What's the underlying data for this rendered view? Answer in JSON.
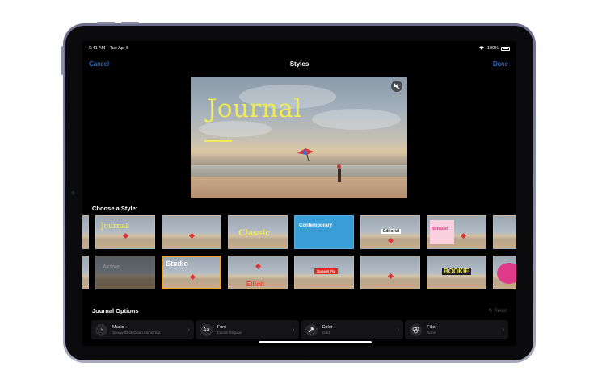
{
  "status": {
    "time": "9:41 AM",
    "date": "Tue Apr 5",
    "battery": "100%"
  },
  "nav": {
    "cancel": "Cancel",
    "title": "Styles",
    "done": "Done"
  },
  "preview": {
    "title": "Journal"
  },
  "choose_label": "Choose a Style:",
  "style_tiles_row1": [
    {
      "text": "",
      "color": "#f2ea55"
    },
    {
      "text": "Journal",
      "color": "#f2ea55"
    },
    {
      "text": "",
      "color": "#ffffff"
    },
    {
      "text": "Classic",
      "color": "#f2ea55"
    },
    {
      "text": "Contemporary",
      "color": "#ffffff"
    },
    {
      "text": "Editorial",
      "color": "#222222"
    },
    {
      "text": "Notepad",
      "color": "#e03a8a"
    },
    {
      "text": "",
      "color": "#f2ea55"
    }
  ],
  "style_tiles_row2": [
    {
      "text": "",
      "color": "#ffffff"
    },
    {
      "text": "Active",
      "color": "#ffffff"
    },
    {
      "text": "Studio",
      "color": "#ffffff"
    },
    {
      "text": "Elliott",
      "color": "#ff3b30"
    },
    {
      "text": "Sunset Fix",
      "color": "#ffffff"
    },
    {
      "text": "",
      "color": "#ffffff"
    },
    {
      "text": "BOOKIE",
      "color": "#f2ea55"
    },
    {
      "text": "",
      "color": "#e03a8a"
    }
  ],
  "options_label": "Journal Options",
  "reset_label": "Reset",
  "options": [
    {
      "label": "Music",
      "value": "Snowy Stroll Down Monstreat",
      "icon": "music-note-icon"
    },
    {
      "label": "Font",
      "value": "Carole Regular",
      "icon": "font-icon"
    },
    {
      "label": "Color",
      "value": "Gold",
      "icon": "eyedropper-icon"
    },
    {
      "label": "Filter",
      "value": "None",
      "icon": "filter-icon"
    }
  ],
  "colors": {
    "accent": "#2f8bff",
    "selection": "#f5a623",
    "title_yellow": "#f2ea55"
  }
}
